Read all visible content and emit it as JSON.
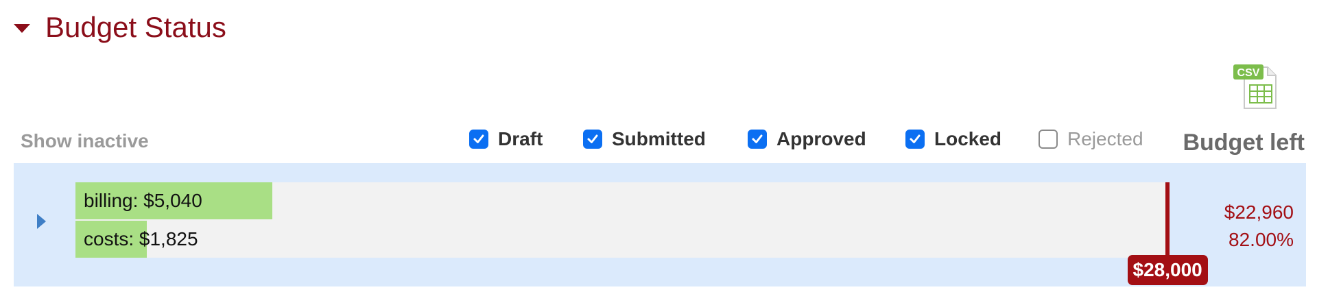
{
  "section": {
    "title": "Budget Status"
  },
  "csv": {
    "label": "CSV"
  },
  "controls": {
    "show_inactive": "Show inactive",
    "filters": [
      {
        "label": "Draft",
        "checked": true
      },
      {
        "label": "Submitted",
        "checked": true
      },
      {
        "label": "Approved",
        "checked": true
      },
      {
        "label": "Locked",
        "checked": true
      },
      {
        "label": "Rejected",
        "checked": false
      }
    ],
    "budget_left_header": "Budget left"
  },
  "budget_row": {
    "billing_label": "billing: $5,040",
    "costs_label": "costs: $1,825",
    "billing_value": 5040,
    "costs_value": 1825,
    "limit_value": 28000,
    "limit_label": "$28,000",
    "remaining_amount": "$22,960",
    "remaining_percent": "82.00%"
  },
  "colors": {
    "accent": "#8b0e1a",
    "bar_fill": "#a9df85",
    "limit": "#a30f14",
    "row_bg": "#dbeafc",
    "checkbox": "#0b6ff2"
  }
}
